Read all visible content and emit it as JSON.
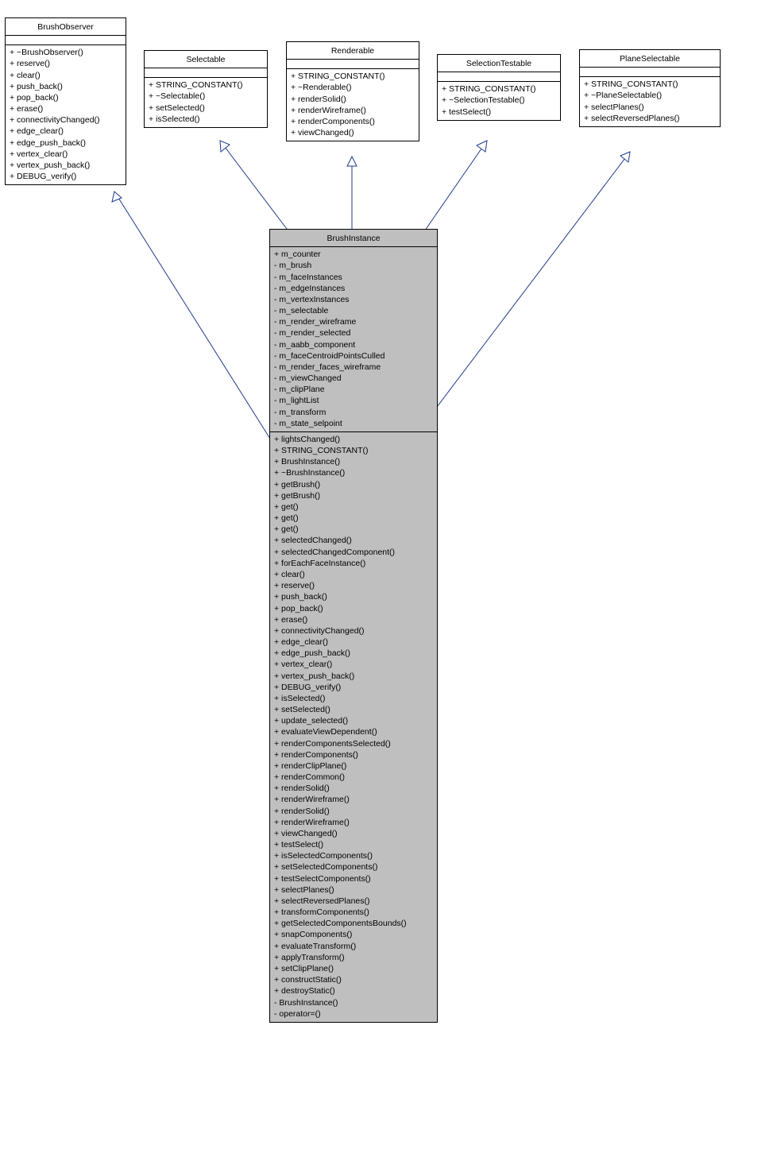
{
  "classes": {
    "brushObserver": {
      "title": "BrushObserver",
      "methods": [
        "+ ~BrushObserver()",
        "+ reserve()",
        "+ clear()",
        "+ push_back()",
        "+ pop_back()",
        "+ erase()",
        "+ connectivityChanged()",
        "+ edge_clear()",
        "+ edge_push_back()",
        "+ vertex_clear()",
        "+ vertex_push_back()",
        "+ DEBUG_verify()"
      ]
    },
    "selectable": {
      "title": "Selectable",
      "methods": [
        "+ STRING_CONSTANT()",
        "+ ~Selectable()",
        "+ setSelected()",
        "+ isSelected()"
      ]
    },
    "renderable": {
      "title": "Renderable",
      "methods": [
        "+ STRING_CONSTANT()",
        "+ ~Renderable()",
        "+ renderSolid()",
        "+ renderWireframe()",
        "+ renderComponents()",
        "+ viewChanged()"
      ]
    },
    "selectionTestable": {
      "title": "SelectionTestable",
      "methods": [
        "+ STRING_CONSTANT()",
        "+ ~SelectionTestable()",
        "+ testSelect()"
      ]
    },
    "planeSelectable": {
      "title": "PlaneSelectable",
      "methods": [
        "+ STRING_CONSTANT()",
        "+ ~PlaneSelectable()",
        "+ selectPlanes()",
        "+ selectReversedPlanes()"
      ]
    },
    "brushInstance": {
      "title": "BrushInstance",
      "attrs": [
        "+ m_counter",
        "- m_brush",
        "- m_faceInstances",
        "- m_edgeInstances",
        "- m_vertexInstances",
        "- m_selectable",
        "- m_render_wireframe",
        "- m_render_selected",
        "- m_aabb_component",
        "- m_faceCentroidPointsCulled",
        "- m_render_faces_wireframe",
        "- m_viewChanged",
        "- m_clipPlane",
        "- m_lightList",
        "- m_transform",
        "- m_state_selpoint"
      ],
      "methods": [
        "+ lightsChanged()",
        "+ STRING_CONSTANT()",
        "+ BrushInstance()",
        "+ ~BrushInstance()",
        "+ getBrush()",
        "+ getBrush()",
        "+ get()",
        "+ get()",
        "+ get()",
        "+ selectedChanged()",
        "+ selectedChangedComponent()",
        "+ forEachFaceInstance()",
        "+ clear()",
        "+ reserve()",
        "+ push_back()",
        "+ pop_back()",
        "+ erase()",
        "+ connectivityChanged()",
        "+ edge_clear()",
        "+ edge_push_back()",
        "+ vertex_clear()",
        "+ vertex_push_back()",
        "+ DEBUG_verify()",
        "+ isSelected()",
        "+ setSelected()",
        "+ update_selected()",
        "+ evaluateViewDependent()",
        "+ renderComponentsSelected()",
        "+ renderComponents()",
        "+ renderClipPlane()",
        "+ renderCommon()",
        "+ renderSolid()",
        "+ renderWireframe()",
        "+ renderSolid()",
        "+ renderWireframe()",
        "+ viewChanged()",
        "+ testSelect()",
        "+ isSelectedComponents()",
        "+ setSelectedComponents()",
        "+ testSelectComponents()",
        "+ selectPlanes()",
        "+ selectReversedPlanes()",
        "+ transformComponents()",
        "+ getSelectedComponentsBounds()",
        "+ snapComponents()",
        "+ evaluateTransform()",
        "+ applyTransform()",
        "+ setClipPlane()",
        "+ constructStatic()",
        "+ destroyStatic()",
        "- BrushInstance()",
        "- operator=()"
      ]
    }
  }
}
